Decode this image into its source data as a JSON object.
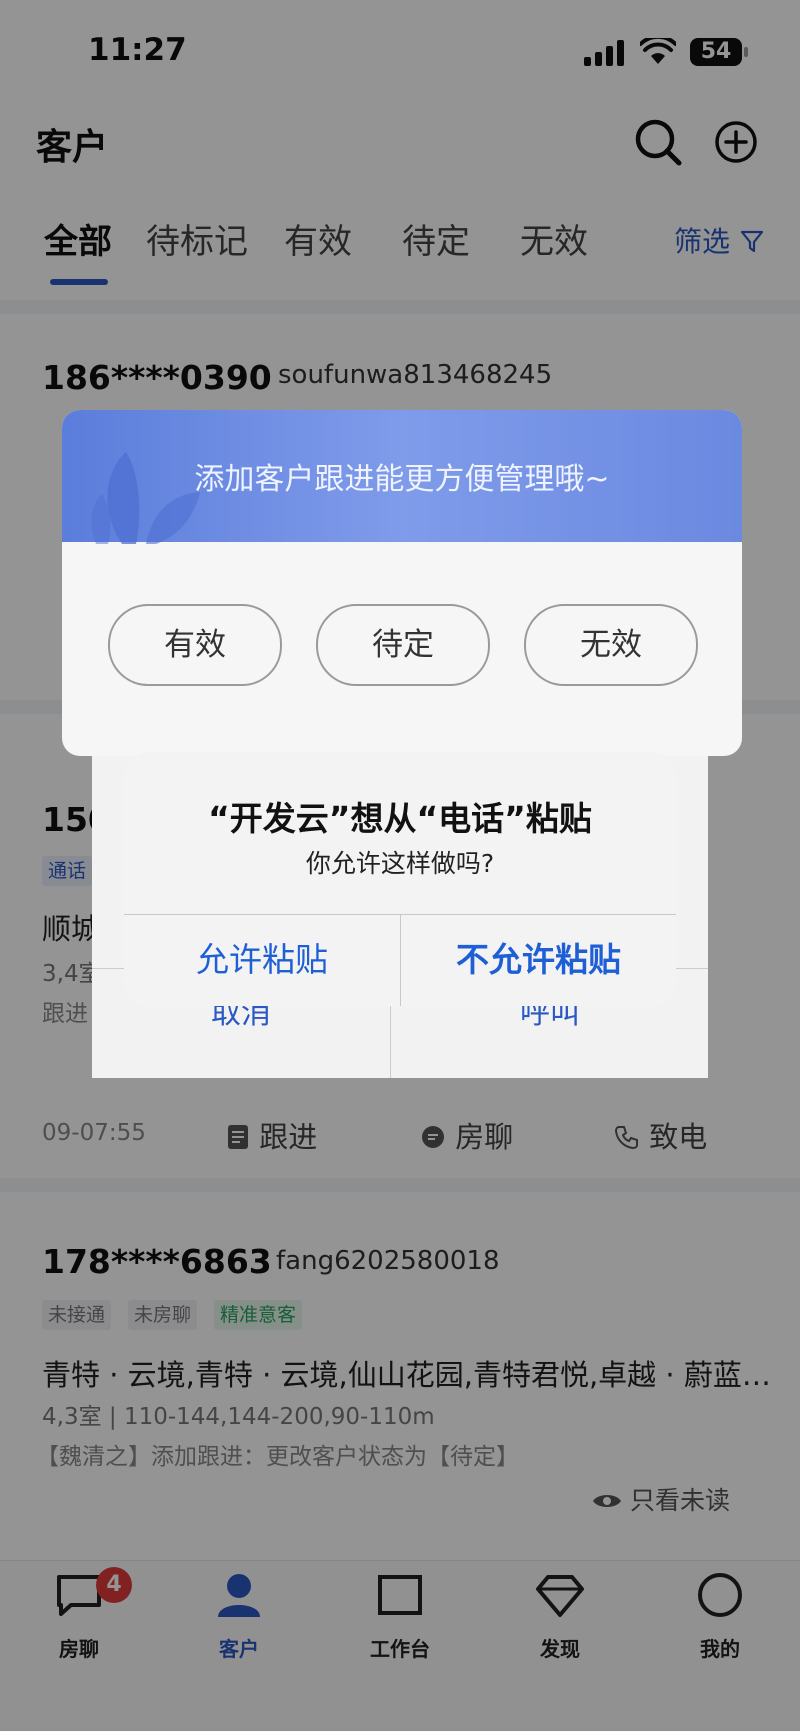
{
  "status_bar": {
    "time": "11:27",
    "battery": "54"
  },
  "header": {
    "title": "客户"
  },
  "tabs": [
    {
      "label": "全部",
      "active": true
    },
    {
      "label": "待标记",
      "active": false
    },
    {
      "label": "有效",
      "active": false
    },
    {
      "label": "待定",
      "active": false
    },
    {
      "label": "无效",
      "active": false
    }
  ],
  "filter_label": "筛选",
  "cards": [
    {
      "phone": "186****0390",
      "uid": "soufunwa813468245"
    },
    {
      "phone": "150",
      "tag": "通话",
      "line1": "顺城",
      "line2": "3,4室",
      "line3": "跟进",
      "time": "09-07:55",
      "actions": [
        "跟进",
        "房聊",
        "致电"
      ]
    },
    {
      "phone": "178****6863",
      "uid": "fang6202580018",
      "tags": [
        "未接通",
        "未房聊",
        "精准意客"
      ],
      "line1": "青特 · 云境,青特 · 云境,仙山花园,青特君悦,卓越 · 蔚蓝…",
      "line2": "4,3室 | 110-144,144-200,90-110m",
      "line3": "【魏清之】添加跟进：更改客户状态为【待定】",
      "only_unread": "只看未读"
    }
  ],
  "status_popup": {
    "title": "添加客户跟进能更方便管理哦~",
    "options": [
      "有效",
      "待定",
      "无效"
    ]
  },
  "call_dialog": {
    "cancel": "取消",
    "call": "呼叫"
  },
  "paste_alert": {
    "title": "“开发云”想从“电话”粘贴",
    "message": "你允许这样做吗?",
    "allow": "允许粘贴",
    "deny": "不允许粘贴"
  },
  "bottom_nav": {
    "badge": "4",
    "items": [
      {
        "label": "房聊",
        "icon": "chat-icon"
      },
      {
        "label": "客户",
        "icon": "user-icon",
        "active": true
      },
      {
        "label": "工作台",
        "icon": "workbench-icon"
      },
      {
        "label": "发现",
        "icon": "diamond-icon"
      },
      {
        "label": "我的",
        "icon": "profile-icon"
      }
    ]
  },
  "colors": {
    "accent": "#2b59c3",
    "badge": "#e03a3a",
    "ios_blue": "#1f5fd6"
  }
}
